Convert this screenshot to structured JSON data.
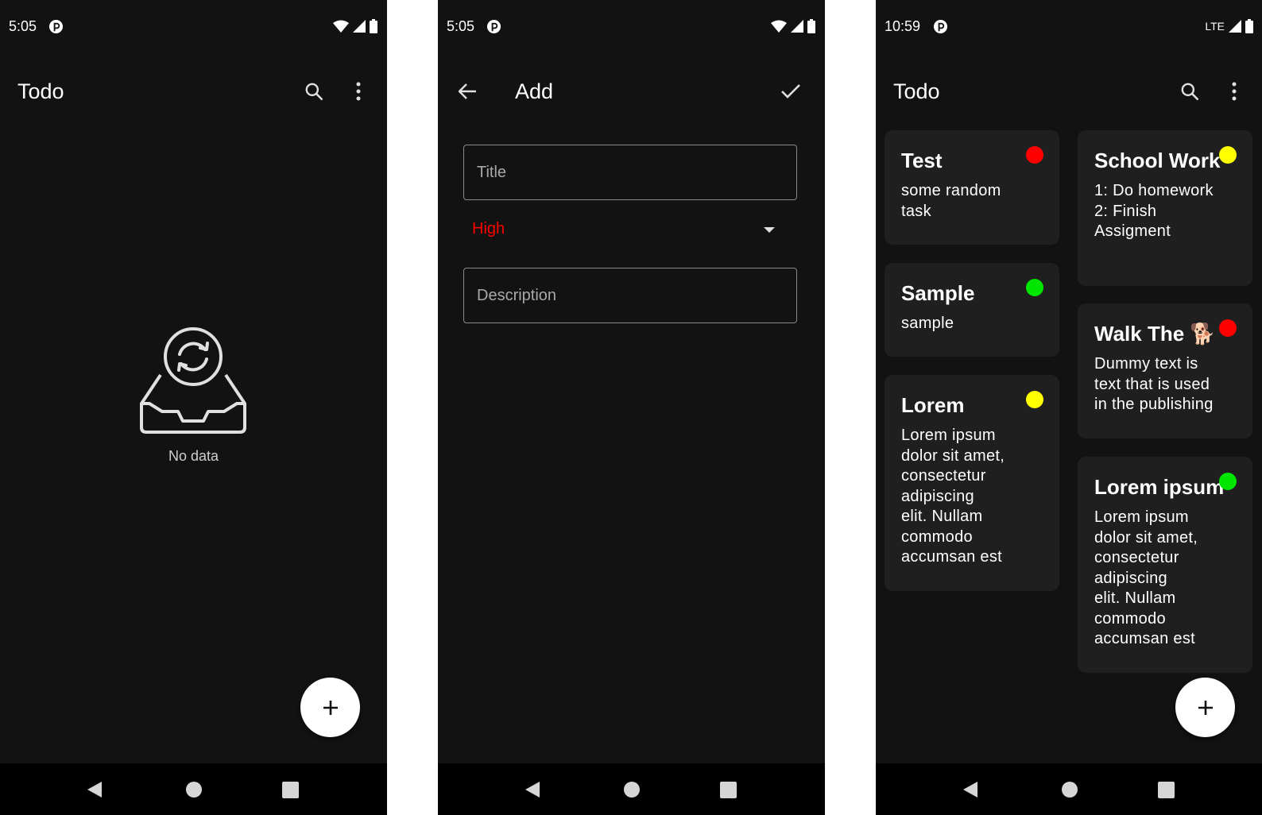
{
  "colors": {
    "background": "#121212",
    "card": "#1f1f1f",
    "navbar": "#000000",
    "priority_high": "#ff0000",
    "priority_medium": "#ffff00",
    "priority_low": "#00e600"
  },
  "screens": [
    {
      "status_time": "5:05",
      "appbar": {
        "title": "Todo",
        "search_icon": "search-icon",
        "menu_icon": "more-vert-icon"
      },
      "empty_state": {
        "icon": "empty-inbox-icon",
        "text": "No data"
      },
      "fab_icon": "add-icon"
    },
    {
      "status_time": "5:05",
      "appbar": {
        "title": "Add",
        "back_icon": "arrow-back-icon",
        "confirm_icon": "check-icon"
      },
      "form": {
        "title_placeholder": "Title",
        "priority_selected": "High",
        "description_placeholder": "Description"
      }
    },
    {
      "status_time": "10:59",
      "network_label": "LTE",
      "appbar": {
        "title": "Todo",
        "search_icon": "search-icon",
        "menu_icon": "more-vert-icon"
      },
      "fab_icon": "add-icon",
      "notes": [
        {
          "title": "Test",
          "description": "some random\ntask",
          "priority": "high"
        },
        {
          "title": "Sample",
          "description": "sample",
          "priority": "low"
        },
        {
          "title": "Lorem",
          "description": "Lorem ipsum\ndolor sit amet,\nconsectetur\nadipiscing\nelit. Nullam\ncommodo\naccumsan est",
          "priority": "medium"
        },
        {
          "title": "School Work",
          "description": "1: Do homework\n2: Finish\nAssigment",
          "priority": "medium"
        },
        {
          "title": "Walk The 🐕",
          "description": "Dummy text is\ntext that is used\nin the publishing",
          "priority": "high"
        },
        {
          "title": "Lorem ipsum",
          "description": "Lorem ipsum\ndolor sit amet,\nconsectetur\nadipiscing\nelit. Nullam\ncommodo\naccumsan est",
          "priority": "low"
        }
      ]
    }
  ]
}
